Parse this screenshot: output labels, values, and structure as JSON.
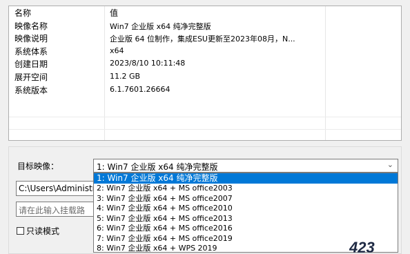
{
  "props": {
    "header": {
      "name": "名称",
      "value": "值"
    },
    "rows": [
      {
        "name": "映像名称",
        "value": "Win7 企业版 x64 纯净完整版"
      },
      {
        "name": "映像说明",
        "value": "企业版 64 位制作，集成ESU更新至2023年08月，N..."
      },
      {
        "name": "系统体系",
        "value": "x64"
      },
      {
        "name": "创建日期",
        "value": "2023/8/10 10:11:48"
      },
      {
        "name": "展开空间",
        "value": "11.2 GB"
      },
      {
        "name": "系统版本",
        "value": "6.1.7601.26664"
      }
    ]
  },
  "target": {
    "label": "目标映像：",
    "selected": "1: Win7 企业版 x64 纯净完整版",
    "options": [
      "1: Win7 企业版 x64 纯净完整版",
      "2: Win7 企业版 x64 + MS office2003",
      "3: Win7 企业版 x64 + MS office2007",
      "4: Win7 企业版 x64 + MS office2010",
      "5: Win7 企业版 x64 + MS office2013",
      "6: Win7 企业版 x64 + MS office2016",
      "7: Win7 企业版 x64 + MS office2019",
      "8: Win7 企业版 x64 + WPS 2019"
    ]
  },
  "path": {
    "value": "C:\\Users\\Administrat"
  },
  "mount": {
    "placeholder": "请在此输入挂载路"
  },
  "readonly": {
    "label": "只读模式",
    "checked": false
  },
  "logo": {
    "text": "423"
  },
  "icons": {
    "dropdown": "chevron-down-icon"
  }
}
